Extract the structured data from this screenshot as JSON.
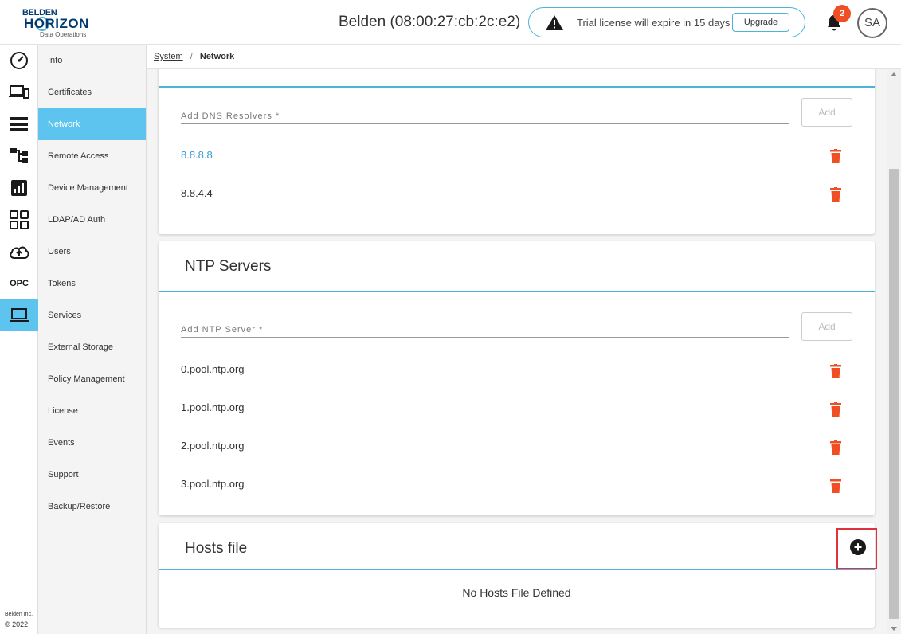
{
  "header": {
    "logo_line1": "BELDEN",
    "logo_line2": "HORIZON",
    "logo_line3": "Data Operations",
    "device_title": "Belden (08:00:27:cb:2c:e2)",
    "license_message": "Trial license will expire in 15 days",
    "upgrade_label": "Upgrade",
    "notification_count": "2",
    "avatar_initials": "SA"
  },
  "rail": {
    "items": [
      "dashboard-icon",
      "devices-icon",
      "list-icon",
      "hierarchy-icon",
      "analytics-icon",
      "apps-grid-icon",
      "cloud-upload-icon",
      "OPC",
      "laptop-icon"
    ],
    "active_index": 8,
    "footer_line1": "Belden Inc.",
    "footer_line2": "© 2022"
  },
  "subnav": {
    "items": [
      {
        "label": "Info"
      },
      {
        "label": "Certificates"
      },
      {
        "label": "Network"
      },
      {
        "label": "Remote Access"
      },
      {
        "label": "Device Management"
      },
      {
        "label": "LDAP/AD Auth"
      },
      {
        "label": "Users"
      },
      {
        "label": "Tokens"
      },
      {
        "label": "Services"
      },
      {
        "label": "External Storage"
      },
      {
        "label": "Policy Management"
      },
      {
        "label": "License"
      },
      {
        "label": "Events"
      },
      {
        "label": "Support"
      },
      {
        "label": "Backup/Restore"
      }
    ],
    "active_index": 2
  },
  "breadcrumb": {
    "root": "System",
    "separator": "/",
    "current": "Network"
  },
  "dns": {
    "placeholder": "Add DNS Resolvers *",
    "add_label": "Add",
    "entries": [
      "8.8.8.8",
      "8.8.4.4"
    ]
  },
  "ntp": {
    "title": "NTP Servers",
    "placeholder": "Add NTP Server *",
    "add_label": "Add",
    "entries": [
      "0.pool.ntp.org",
      "1.pool.ntp.org",
      "2.pool.ntp.org",
      "3.pool.ntp.org"
    ]
  },
  "hosts": {
    "title": "Hosts file",
    "add_icon": "+",
    "empty_message": "No Hosts File Defined"
  },
  "colors": {
    "accent": "#5cc4ee",
    "divider": "#4fb3d9",
    "danger": "#f04e23",
    "highlight": "#e0323c"
  }
}
